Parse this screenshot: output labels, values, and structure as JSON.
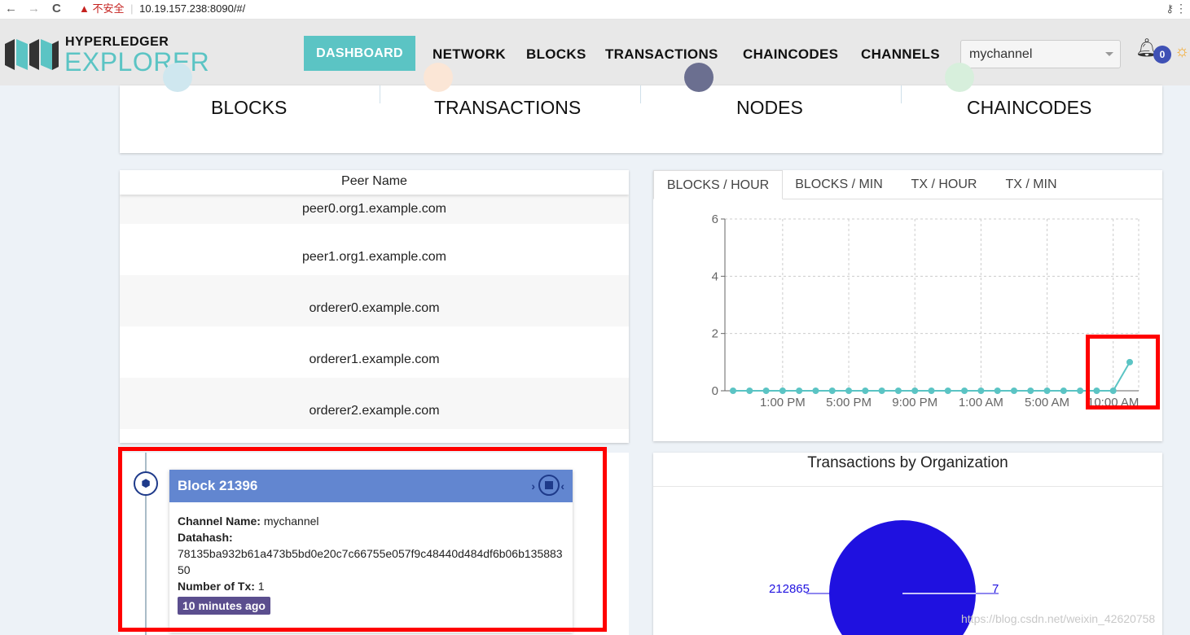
{
  "browser": {
    "back": "←",
    "forward": "→",
    "reload": "C",
    "security_icon": "warning-triangle-icon",
    "security_text": "不安全",
    "separator": "|",
    "url": "10.19.157.238:8090/#/"
  },
  "header": {
    "logo_line1": "HYPERLEDGER",
    "logo_line2": "EXPLORER",
    "nav": {
      "dashboard": "DASHBOARD",
      "network": "NETWORK",
      "blocks": "BLOCKS",
      "transactions": "TRANSACTIONS",
      "chaincodes": "CHAINCODES",
      "channels": "CHANNELS"
    },
    "channel_selected": "mychannel",
    "notification_count": "0"
  },
  "stats": {
    "blocks_label": "BLOCKS",
    "transactions_label": "TRANSACTIONS",
    "nodes_label": "NODES",
    "chaincodes_label": "CHAINCODES"
  },
  "peers": {
    "header": "Peer Name",
    "rows": [
      "peer0.org1.example.com",
      "peer1.org1.example.com",
      "orderer0.example.com",
      "orderer1.example.com",
      "orderer2.example.com"
    ]
  },
  "chart_tabs": {
    "blocks_hour": "BLOCKS / HOUR",
    "blocks_min": "BLOCKS / MIN",
    "tx_hour": "TX / HOUR",
    "tx_min": "TX / MIN"
  },
  "chart_data": [
    {
      "type": "line",
      "x_tick_labels": [
        "1:00 PM",
        "5:00 PM",
        "9:00 PM",
        "1:00 AM",
        "5:00 AM",
        "10:00 AM"
      ],
      "yticks": [
        0,
        2,
        4,
        6
      ],
      "ylim": [
        0,
        6
      ],
      "values": [
        0,
        0,
        0,
        0,
        0,
        0,
        0,
        0,
        0,
        0,
        0,
        0,
        0,
        0,
        0,
        0,
        0,
        0,
        0,
        0,
        0,
        0,
        0,
        0,
        1
      ],
      "grid": true,
      "color": "#5bc4c4"
    },
    {
      "type": "pie",
      "title": "Transactions by Organization",
      "labels": [
        "212865",
        "7"
      ],
      "values": [
        212865,
        7
      ],
      "color": "#1f11e0"
    }
  ],
  "block": {
    "title": "Block 21396",
    "channel_label": "Channel Name:",
    "channel_value": "mychannel",
    "datahash_label": "Datahash:",
    "datahash_value": "78135ba932b61a473b5bd0e20c7c66755e057f9c48440d484df6b06b13588350",
    "tx_label": "Number of Tx:",
    "tx_value": "1",
    "time_ago": "10 minutes ago"
  },
  "watermark": "https://blog.csdn.net/weixin_42620758"
}
